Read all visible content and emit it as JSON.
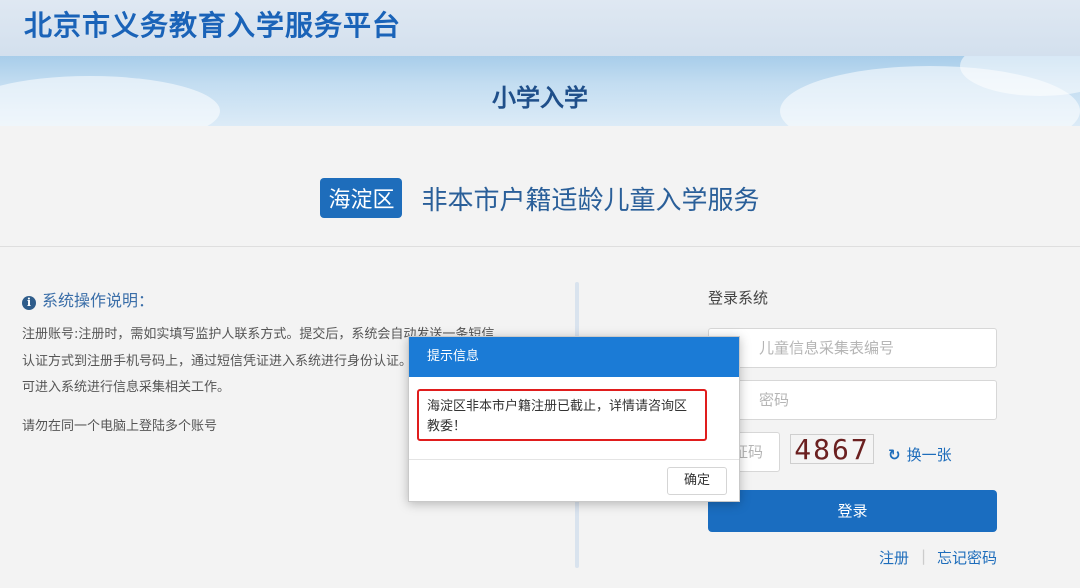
{
  "header": {
    "site_title": "北京市义务教育入学服务平台"
  },
  "banner": {
    "title": "小学入学"
  },
  "service": {
    "district": "海淀区",
    "title": "非本市户籍适龄儿童入学服务"
  },
  "instructions": {
    "title": "系统操作说明：",
    "lines": [
      "注册账号:注册时，需如实填写监护人联系方式。提交后，系统会自动发送一条短信",
      "认证方式到注册手机号码上，通过短信凭证进入系统进行身份认证。",
      "可进入系统进行信息采集相关工作。",
      "请勿在同一个电脑上登陆多个账号"
    ]
  },
  "login": {
    "title": "登录系统",
    "id_placeholder": "儿童信息采集表编号",
    "password_placeholder": "密码",
    "captcha_placeholder": "证码",
    "captcha_code": "4867",
    "refresh_label": "换一张",
    "login_label": "登录",
    "register_label": "注册",
    "separator": "|",
    "forgot_label": "忘记密码"
  },
  "dialog": {
    "title": "提示信息",
    "message": "海淀区非本市户籍注册已截止，详情请咨询区教委！",
    "ok_label": "确定"
  },
  "colors": {
    "primary": "#1a6dc0",
    "dialog_header": "#1b7bd6",
    "highlight": "#e01d1d"
  }
}
